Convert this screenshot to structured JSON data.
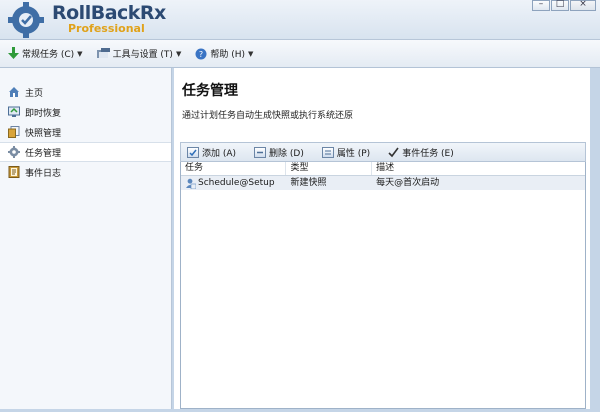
{
  "app": {
    "brand": "RollBackRx",
    "edition": "Professional"
  },
  "window_controls": {
    "minimize": "–",
    "maximize": "□",
    "close": "×"
  },
  "toolbar": {
    "items": [
      {
        "label": "常规任务 (C)",
        "icon": "green-down-arrow-icon"
      },
      {
        "label": "工具与设置 (T)",
        "icon": "tools-icon"
      },
      {
        "label": "帮助 (H)",
        "icon": "help-icon"
      }
    ]
  },
  "sidebar": {
    "items": [
      {
        "label": "主页",
        "icon": "home-icon",
        "active": false
      },
      {
        "label": "即时恢复",
        "icon": "restore-icon",
        "active": false
      },
      {
        "label": "快照管理",
        "icon": "snapshot-icon",
        "active": false
      },
      {
        "label": "任务管理",
        "icon": "gear-icon",
        "active": true
      },
      {
        "label": "事件日志",
        "icon": "log-icon",
        "active": false
      }
    ]
  },
  "main": {
    "title": "任务管理",
    "description": "通过计划任务自动生成快照或执行系统还原",
    "actions": [
      {
        "label": "添加 (A)",
        "icon": "add-icon"
      },
      {
        "label": "删除 (D)",
        "icon": "delete-icon"
      },
      {
        "label": "属性 (P)",
        "icon": "properties-icon"
      },
      {
        "label": "事件任务 (E)",
        "icon": "check-icon"
      }
    ],
    "table": {
      "columns": [
        "任务",
        "类型",
        "描述"
      ],
      "rows": [
        {
          "task": "Schedule@Setup",
          "type": "新建快照",
          "description": "每天@首次启动"
        }
      ]
    }
  },
  "colors": {
    "accent": "#2c4a73",
    "brand_sub": "#e0a21a",
    "sidebar_bg": "#f4f7fb",
    "frame": "#c5d5e7"
  }
}
